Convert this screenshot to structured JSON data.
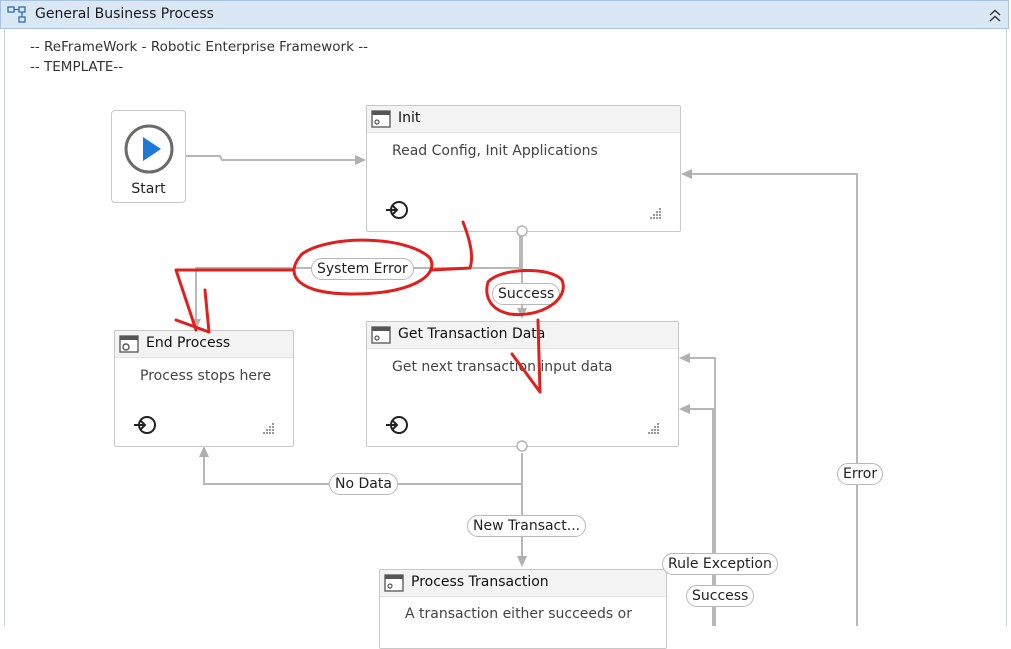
{
  "window": {
    "title": "General Business Process"
  },
  "comments": [
    "-- ReFrameWork - Robotic Enterprise Framework --",
    "-- TEMPLATE--"
  ],
  "start": {
    "label": "Start"
  },
  "states": {
    "init": {
      "title": "Init",
      "description": "Read Config, Init Applications"
    },
    "end_process": {
      "title": "End Process",
      "description": "Process stops here"
    },
    "get_transaction": {
      "title": "Get Transaction Data",
      "description": "Get next transaction input data"
    },
    "process_transaction": {
      "title": "Process Transaction",
      "description": "A transaction either succeeds or"
    }
  },
  "transitions": {
    "system_error": "System Error",
    "success_init": "Success",
    "no_data": "No Data",
    "new_transaction": "New Transact...",
    "rule_exception": "Rule Exception",
    "success_process": "Success",
    "error": "Error"
  },
  "colors": {
    "annotation": "#e0201f",
    "connector": "#b8b8b8",
    "play_icon": "#1e78d8",
    "header": "#dae8f6"
  }
}
